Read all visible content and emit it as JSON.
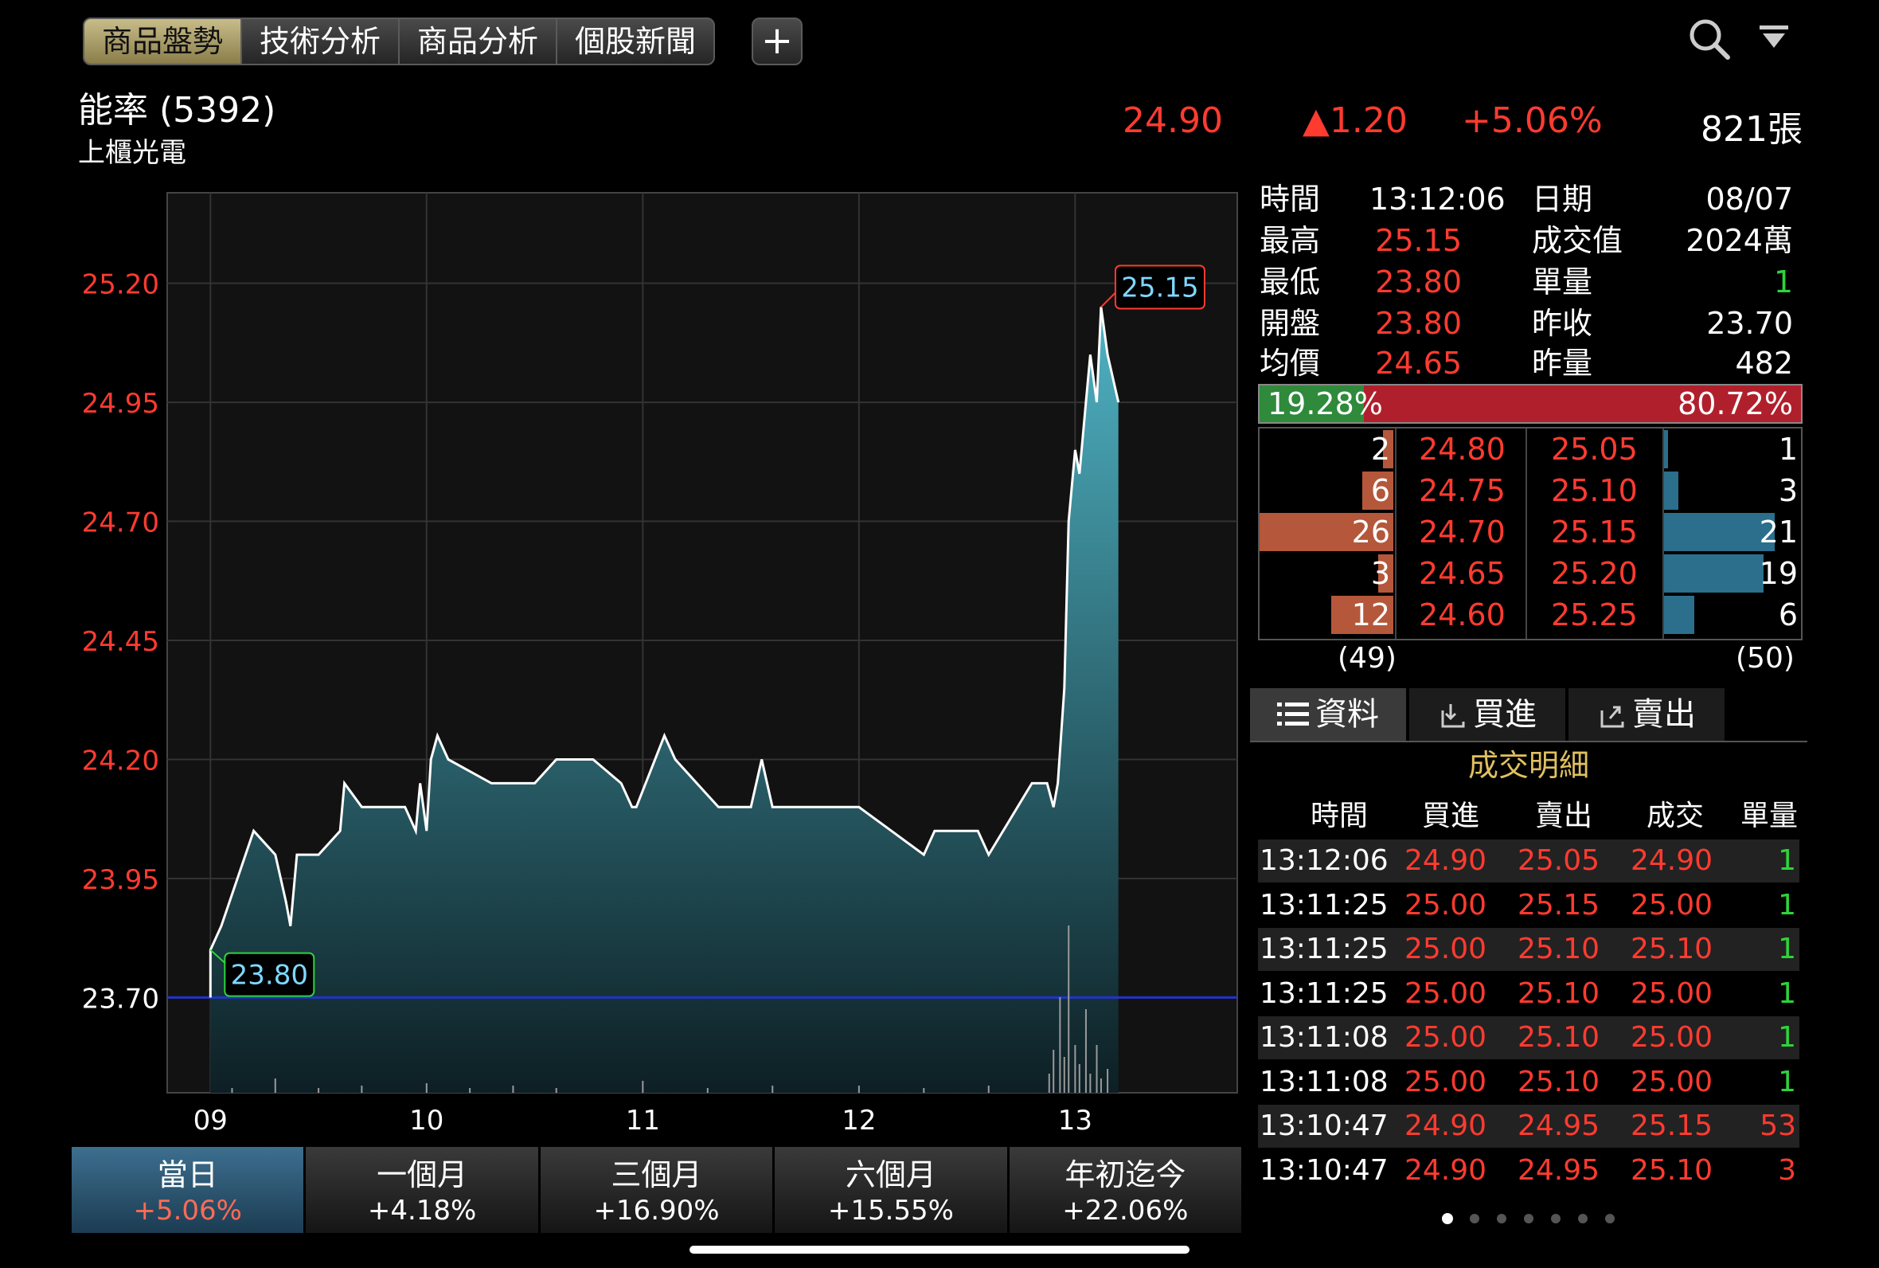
{
  "tabs": [
    "商品盤勢",
    "技術分析",
    "商品分析",
    "個股新聞"
  ],
  "plus_label": "+",
  "stock": {
    "name": "能率 (5392)",
    "category": "上櫃光電",
    "price": "24.90",
    "change": "▲1.20",
    "change_pct": "+5.06%",
    "volume": "821張"
  },
  "info": {
    "time_label": "時間",
    "time": "13:12:06",
    "date_label": "日期",
    "date": "08/07",
    "high_label": "最高",
    "high": "25.15",
    "value_label": "成交值",
    "value": "2024萬",
    "low_label": "最低",
    "low": "23.80",
    "unit_vol_label": "單量",
    "unit_vol": "1",
    "open_label": "開盤",
    "open": "23.80",
    "prev_close_label": "昨收",
    "prev_close": "23.70",
    "avg_label": "均價",
    "avg": "24.65",
    "prev_vol_label": "昨量",
    "prev_vol": "482"
  },
  "ratio": {
    "buy": "19.28%",
    "sell": "80.72%",
    "buy_fraction": 0.1928
  },
  "order_book": {
    "rows": [
      {
        "bid_qty": "2",
        "bid": "24.80",
        "ask": "25.05",
        "ask_qty": "1",
        "bid_n": 2,
        "ask_n": 1
      },
      {
        "bid_qty": "6",
        "bid": "24.75",
        "ask": "25.10",
        "ask_qty": "3",
        "bid_n": 6,
        "ask_n": 3
      },
      {
        "bid_qty": "26",
        "bid": "24.70",
        "ask": "25.15",
        "ask_qty": "21",
        "bid_n": 26,
        "ask_n": 21
      },
      {
        "bid_qty": "3",
        "bid": "24.65",
        "ask": "25.20",
        "ask_qty": "19",
        "bid_n": 3,
        "ask_n": 19
      },
      {
        "bid_qty": "12",
        "bid": "24.60",
        "ask": "25.25",
        "ask_qty": "6",
        "bid_n": 12,
        "ask_n": 6
      }
    ],
    "bid_total": "(49)",
    "ask_total": "(50)"
  },
  "info_tabs": [
    "資料",
    "買進",
    "賣出"
  ],
  "trades": {
    "title": "成交明細",
    "headers": [
      "時間",
      "買進",
      "賣出",
      "成交",
      "單量"
    ],
    "rows": [
      [
        "13:12:06",
        "24.90",
        "25.05",
        "24.90",
        "1"
      ],
      [
        "13:11:25",
        "25.00",
        "25.15",
        "25.00",
        "1"
      ],
      [
        "13:11:25",
        "25.00",
        "25.10",
        "25.10",
        "1"
      ],
      [
        "13:11:25",
        "25.00",
        "25.10",
        "25.00",
        "1"
      ],
      [
        "13:11:08",
        "25.00",
        "25.10",
        "25.00",
        "1"
      ],
      [
        "13:11:08",
        "25.00",
        "25.10",
        "25.00",
        "1"
      ],
      [
        "13:10:47",
        "24.90",
        "24.95",
        "25.15",
        "53"
      ],
      [
        "13:10:47",
        "24.90",
        "24.95",
        "25.10",
        "3"
      ]
    ]
  },
  "periods": [
    {
      "label": "當日",
      "value": "+5.06%"
    },
    {
      "label": "一個月",
      "value": "+4.18%"
    },
    {
      "label": "三個月",
      "value": "+16.90%"
    },
    {
      "label": "六個月",
      "value": "+15.55%"
    },
    {
      "label": "年初迄今",
      "value": "+22.06%"
    }
  ],
  "colors": {
    "up": "#ff3b30",
    "down": "#2ed43a",
    "area_top": "#4fb3c4",
    "area_bottom": "#0d1f24",
    "ref_line": "#2233cc"
  },
  "chart_data": {
    "type": "area",
    "x_ticks": [
      "09",
      "10",
      "11",
      "12",
      "13"
    ],
    "y_ticks": [
      "25.20",
      "24.95",
      "24.70",
      "24.45",
      "24.20",
      "23.95",
      "23.70"
    ],
    "ylim": [
      23.5,
      25.39
    ],
    "reference": 23.7,
    "high_label": "25.15",
    "low_label": "23.80",
    "x_hours": [
      9.0,
      9.0,
      9.05,
      9.2,
      9.3,
      9.35,
      9.37,
      9.4,
      9.5,
      9.6,
      9.62,
      9.7,
      9.8,
      9.9,
      9.95,
      9.97,
      10.0,
      10.02,
      10.05,
      10.1,
      10.3,
      10.5,
      10.6,
      10.75,
      10.77,
      10.9,
      10.95,
      10.97,
      11.1,
      11.15,
      11.25,
      11.35,
      11.5,
      11.55,
      11.6,
      12.0,
      12.15,
      12.3,
      12.35,
      12.55,
      12.6,
      12.8,
      12.87,
      12.9,
      12.92,
      12.95,
      12.97,
      13.0,
      13.02,
      13.05,
      13.07,
      13.1,
      13.12,
      13.15,
      13.2
    ],
    "prices": [
      23.7,
      23.8,
      23.85,
      24.05,
      24.0,
      23.9,
      23.85,
      24.0,
      24.0,
      24.05,
      24.15,
      24.1,
      24.1,
      24.1,
      24.05,
      24.15,
      24.05,
      24.2,
      24.25,
      24.2,
      24.15,
      24.15,
      24.2,
      24.2,
      24.2,
      24.15,
      24.1,
      24.1,
      24.25,
      24.2,
      24.15,
      24.1,
      24.1,
      24.2,
      24.1,
      24.1,
      24.05,
      24.0,
      24.05,
      24.05,
      24.0,
      24.15,
      24.15,
      24.1,
      24.15,
      24.35,
      24.7,
      24.85,
      24.8,
      24.95,
      25.05,
      24.95,
      25.15,
      25.05,
      24.95
    ],
    "volume_x": [
      9.1,
      9.3,
      9.5,
      9.7,
      10.0,
      10.2,
      10.4,
      10.6,
      11.0,
      11.3,
      11.6,
      12.0,
      12.3,
      12.6,
      12.88,
      12.9,
      12.93,
      12.95,
      12.97,
      13.0,
      13.02,
      13.05,
      13.07,
      13.1,
      13.12,
      13.15
    ],
    "volume": [
      2,
      6,
      2,
      3,
      4,
      2,
      3,
      2,
      5,
      2,
      3,
      3,
      2,
      3,
      8,
      18,
      40,
      15,
      70,
      20,
      12,
      35,
      8,
      20,
      6,
      10
    ]
  }
}
